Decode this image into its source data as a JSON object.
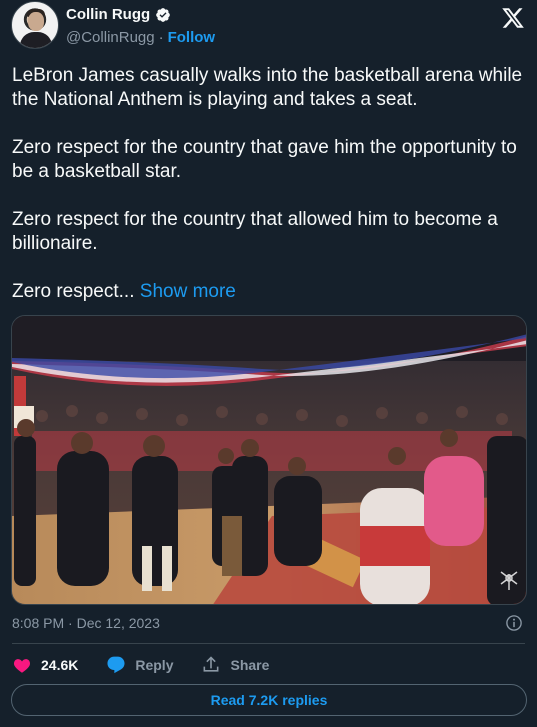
{
  "author": {
    "display_name": "Collin Rugg",
    "handle": "@CollinRugg",
    "separator": "·",
    "follow_label": "Follow"
  },
  "tweet": {
    "paragraphs": [
      "LeBron James casually walks into the basketball arena while the National Anthem is playing and takes a seat.",
      "Zero respect for the country that gave him the opportunity to be a basketball star.",
      "Zero respect for the country that allowed him to become a billionaire."
    ],
    "truncated_text": "Zero respect...",
    "show_more_label": "Show more"
  },
  "meta": {
    "timestamp": "8:08 PM · Dec 12, 2023"
  },
  "actions": {
    "like_count": "24.6K",
    "reply_label": "Reply",
    "share_label": "Share"
  },
  "read_replies_label": "Read 7.2K replies",
  "colors": {
    "background": "#15202b",
    "accent": "#1d9bf0",
    "like": "#f91880",
    "muted": "#8b98a5",
    "border": "#38444d"
  },
  "icons": [
    "verified-badge-icon",
    "x-logo-icon",
    "info-icon",
    "heart-icon",
    "reply-icon",
    "share-icon"
  ]
}
